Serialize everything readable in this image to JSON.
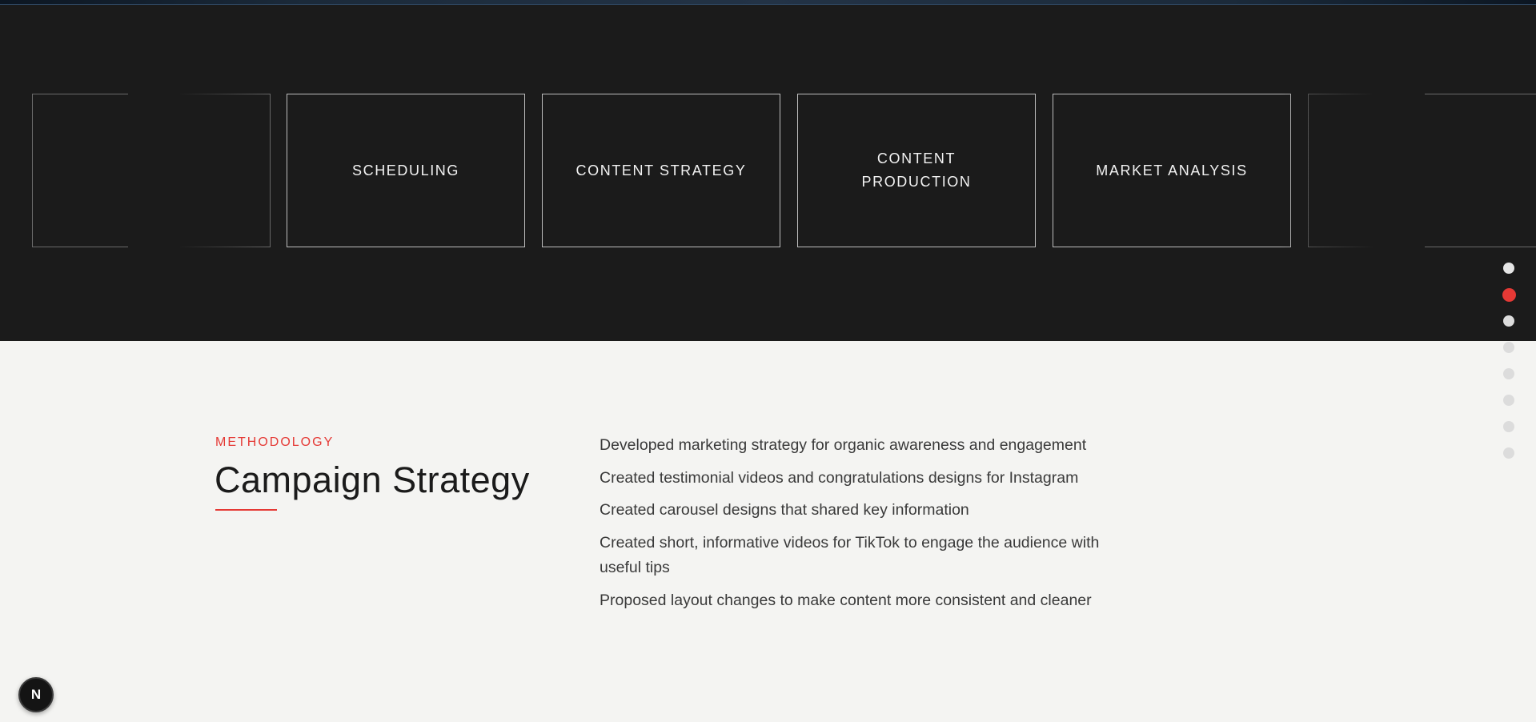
{
  "carousel": {
    "items": [
      {
        "label": ""
      },
      {
        "label": "SCHEDULING"
      },
      {
        "label": "CONTENT STRATEGY"
      },
      {
        "label": "CONTENT PRODUCTION"
      },
      {
        "label": "MARKET ANALYSIS"
      },
      {
        "label": ""
      }
    ]
  },
  "section_nav": {
    "count": 8,
    "active_index": 1
  },
  "methodology": {
    "eyebrow": "METHODOLOGY",
    "title": "Campaign Strategy",
    "bullets": [
      "Developed marketing strategy for organic awareness and engagement",
      "Created testimonial videos and congratulations designs for Instagram",
      "Created carousel designs that shared key information",
      "Created short, informative videos for TikTok to engage the audience with useful tips",
      "Proposed layout changes to make content more consistent and cleaner"
    ]
  },
  "badge": {
    "letter": "N"
  },
  "colors": {
    "accent": "#e53935",
    "dark_background": "#1b1b1b",
    "light_background": "#f4f4f2"
  }
}
